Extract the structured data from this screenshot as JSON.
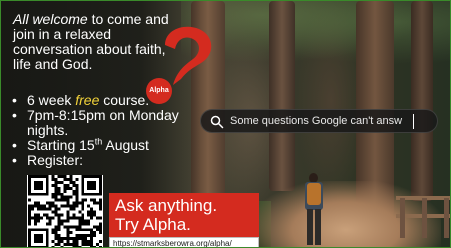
{
  "intro": {
    "lead": "All welcome",
    "rest": " to come and join in a relaxed conversation about faith, life and God."
  },
  "badge": {
    "label": "Alpha"
  },
  "bullets": {
    "item1_pre": "6 week ",
    "item1_em": "free",
    "item1_post": " course.",
    "item2": "7pm-8:15pm on Monday nights.",
    "item3_pre": "Starting 15",
    "item3_sup": "th",
    "item3_post": " August",
    "item4": "Register:"
  },
  "search": {
    "text": "Some questions Google can't answ",
    "icon": "search-icon"
  },
  "cta": {
    "line1": "Ask anything.",
    "line2": "Try Alpha.",
    "url": "https://stmarksberowra.org/alpha/"
  },
  "colors": {
    "accent_red": "#d42b1f",
    "highlight_yellow": "#f2d23a",
    "frame_green": "#3a8a2a"
  }
}
